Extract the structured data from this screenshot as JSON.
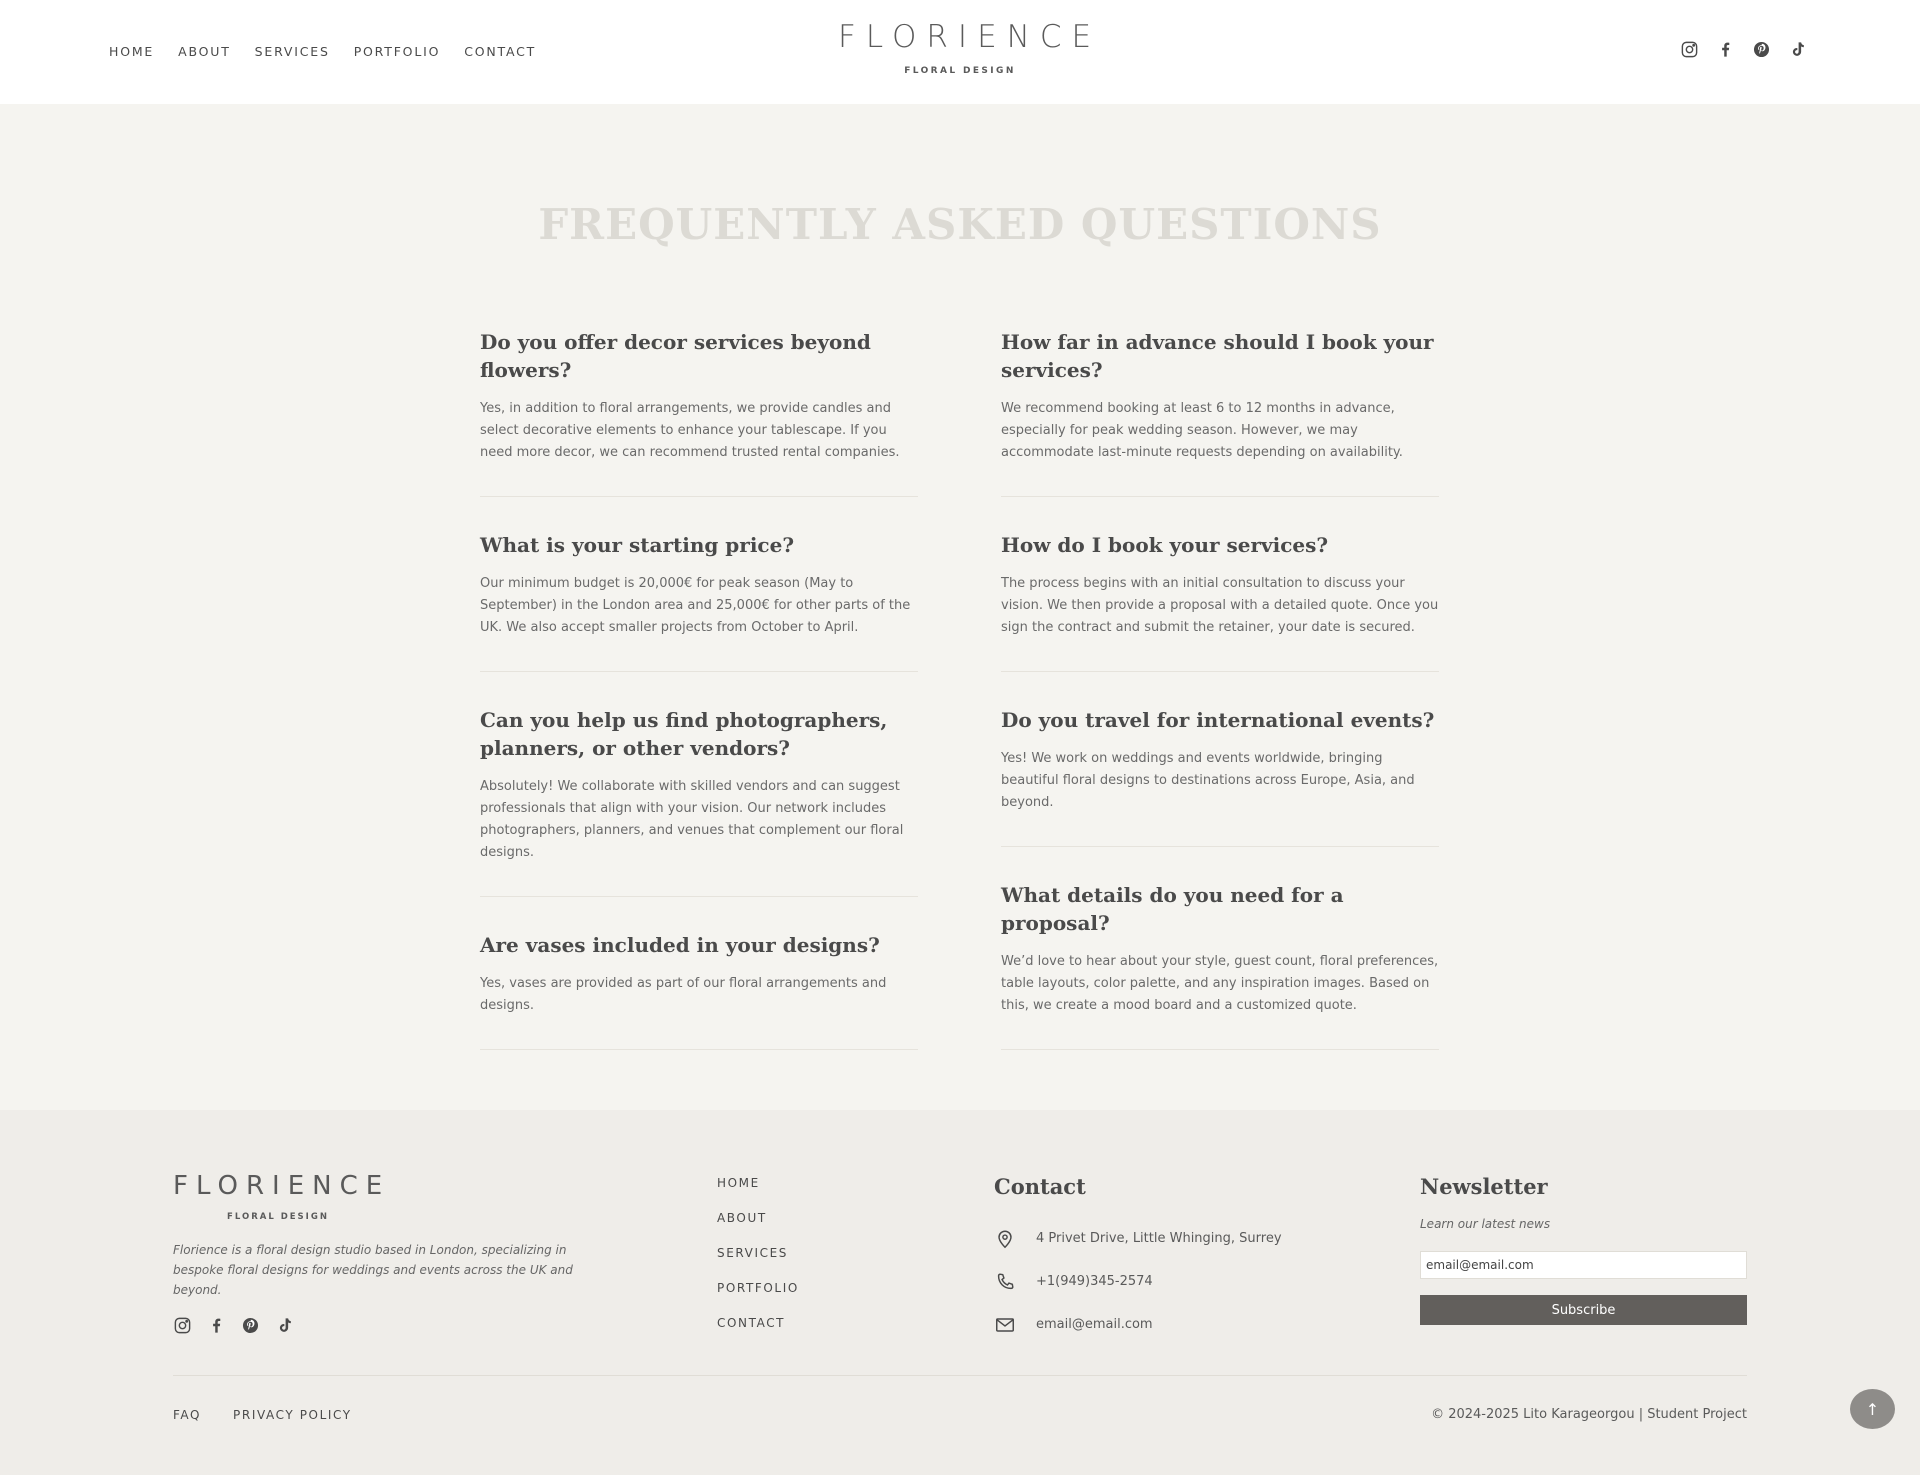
{
  "header": {
    "nav": [
      "HOME",
      "ABOUT",
      "SERVICES",
      "PORTFOLIO",
      "CONTACT"
    ],
    "logo_main": "FLORIENCE",
    "logo_sub": "FLORAL DESIGN",
    "social_icons": [
      "instagram-icon",
      "facebook-icon",
      "pinterest-icon",
      "tiktok-icon"
    ]
  },
  "main": {
    "title": "FREQUENTLY ASKED QUESTIONS",
    "left": [
      {
        "q": "Do you offer decor services beyond flowers?",
        "a": "Yes, in addition to floral arrangements, we provide candles and select decorative elements to enhance your tablescape. If you need more decor, we can recommend trusted rental companies."
      },
      {
        "q": "What is your starting price?",
        "a": "Our minimum budget is 20,000€ for peak season (May to September) in the London area and 25,000€ for other parts of the UK. We also accept smaller projects from October to April."
      },
      {
        "q": "Can you help us find photographers, planners, or other vendors?",
        "a": "Absolutely! We collaborate with skilled vendors and can suggest professionals that align with your vision. Our network includes photographers, planners, and venues that complement our floral designs."
      },
      {
        "q": "Are vases included in your designs?",
        "a": "Yes, vases are provided as part of our floral arrangements and designs."
      }
    ],
    "right": [
      {
        "q": "How far in advance should I book your services?",
        "a": "We recommend booking at least 6 to 12 months in advance, especially for peak wedding season. However, we may accommodate last-minute requests depending on availability."
      },
      {
        "q": "How do I book your services?",
        "a": "The process begins with an initial consultation to discuss your vision. We then provide a proposal with a detailed quote. Once you sign the contract and submit the retainer, your date is secured."
      },
      {
        "q": "Do you travel for international events?",
        "a": "Yes! We work on weddings and events worldwide, bringing beautiful floral designs to destinations across Europe, Asia, and beyond."
      },
      {
        "q": "What details do you need for a proposal?",
        "a": "We’d love to hear about your style, guest count, floral preferences, table layouts, color palette, and any inspiration images. Based on this, we create a mood board and a customized quote."
      }
    ]
  },
  "footer": {
    "logo_main": "FLORIENCE",
    "logo_sub": "FLORAL DESIGN",
    "description": "Florience is a floral design studio based in London, specializing in bespoke floral designs for weddings and events across the UK and beyond.",
    "nav": [
      "HOME",
      "ABOUT",
      "SERVICES",
      "PORTFOLIO",
      "CONTACT"
    ],
    "contact_title": "Contact",
    "address": "4 Privet Drive, Little Whinging, Surrey",
    "phone": "+1(949)345-2574",
    "email": "email@email.com",
    "newsletter_title": "Newsletter",
    "newsletter_label": "Learn our latest news",
    "newsletter_value": "email@email.com",
    "subscribe": "Subscribe",
    "links": [
      "FAQ",
      "PRIVACY POLICY"
    ],
    "copyright": "© 2024-2025 Lito Karageorgou | Student Project",
    "to_top": "↑"
  },
  "colors": {
    "background": "#f5f4f0",
    "footer": "#efede9",
    "text": "#4a4a4a",
    "button": "#625f5c"
  }
}
